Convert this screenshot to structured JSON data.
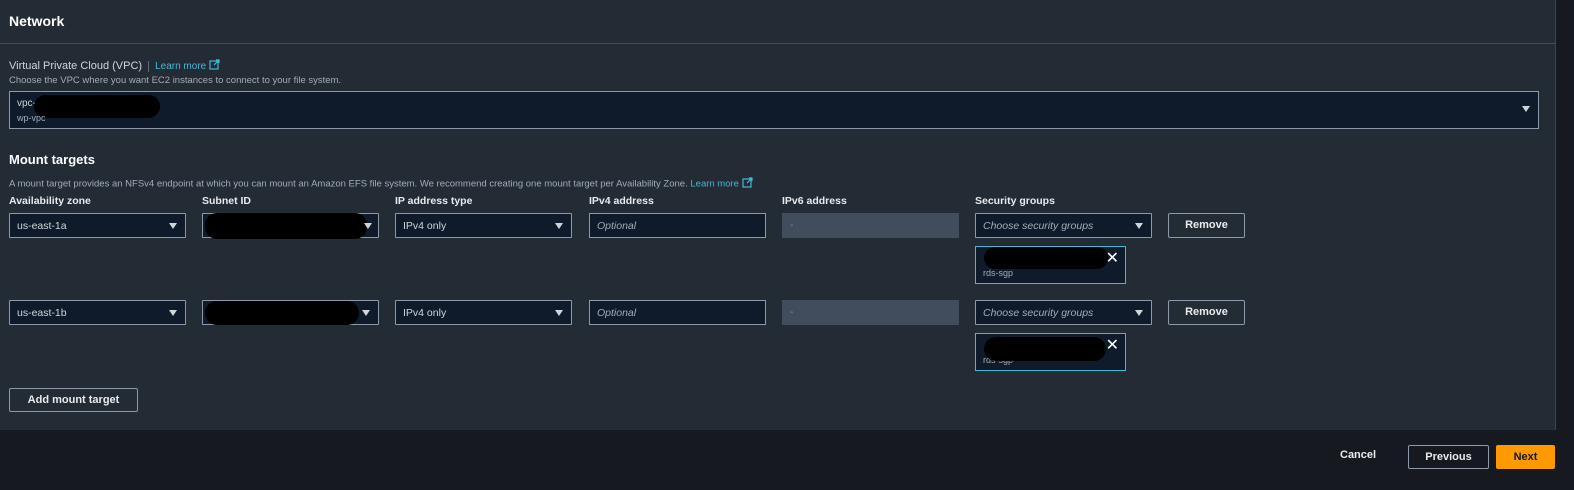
{
  "network": {
    "title": "Network",
    "vpc": {
      "label": "Virtual Private Cloud (VPC)",
      "learn_more": "Learn more",
      "description": "Choose the VPC where you want EC2 instances to connect to your file system.",
      "selected_id_prefix": "vpc-",
      "selected_name": "wp-vpc"
    }
  },
  "mount_targets": {
    "title": "Mount targets",
    "description": "A mount target provides an NFSv4 endpoint at which you can mount an Amazon EFS file system. We recommend creating one mount target per Availability Zone.",
    "learn_more": "Learn more",
    "columns": {
      "az": "Availability zone",
      "subnet": "Subnet ID",
      "ip_type": "IP address type",
      "ipv4": "IPv4 address",
      "ipv6": "IPv6 address",
      "sg": "Security groups"
    },
    "rows": [
      {
        "az": "us-east-1a",
        "ip_type": "IPv4 only",
        "ipv4_placeholder": "Optional",
        "ipv6": "-",
        "sg_placeholder": "Choose security groups",
        "sg_token_name": "rds-sgp",
        "remove": "Remove"
      },
      {
        "az": "us-east-1b",
        "ip_type": "IPv4 only",
        "ipv4_placeholder": "Optional",
        "ipv6": "-",
        "sg_placeholder": "Choose security groups",
        "sg_token_name": "rds-sgp",
        "remove": "Remove"
      }
    ],
    "add_button": "Add mount target"
  },
  "footer": {
    "cancel": "Cancel",
    "previous": "Previous",
    "next": "Next"
  },
  "colors": {
    "accent_link": "#44b9d6",
    "primary_button": "#ff9900",
    "panel_bg": "#232b35",
    "page_bg": "#16191f"
  }
}
